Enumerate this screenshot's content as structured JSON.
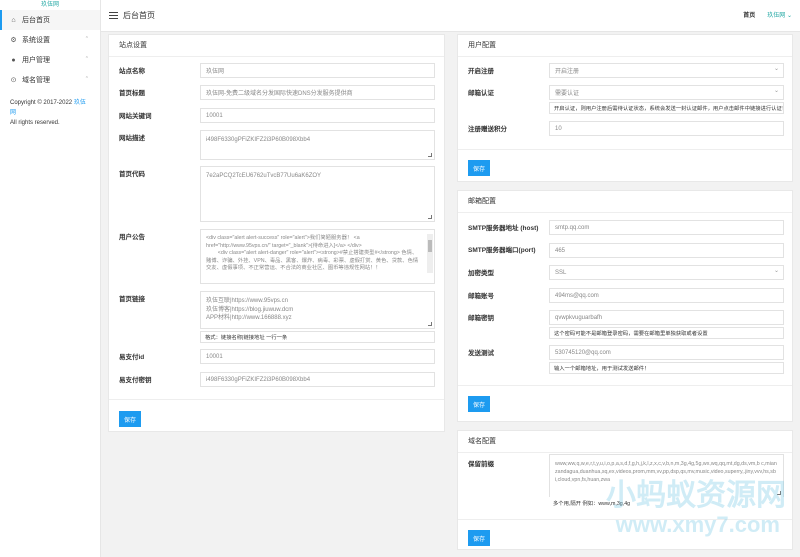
{
  "sidebar": {
    "logo": "玖伍网",
    "items": [
      {
        "label": "后台首页",
        "icon": "home-icon",
        "glyph": "⌂",
        "active": true
      },
      {
        "label": "系统设置",
        "icon": "settings-icon",
        "glyph": "⚙",
        "caret": "⌃"
      },
      {
        "label": "用户管理",
        "icon": "user-icon",
        "glyph": "●",
        "caret": "⌃"
      },
      {
        "label": "域名管理",
        "icon": "globe-icon",
        "glyph": "⊙",
        "caret": "⌃"
      }
    ],
    "copyright_prefix": "Copyright © 2017-2022",
    "copyright_link": "玖伍网",
    "copyright_suffix": "All rights reserved."
  },
  "topbar": {
    "title": "后台首页",
    "home_link": "首页",
    "user": "玖伍网 ⌄"
  },
  "site": {
    "header": "站点设置",
    "fields": {
      "name": {
        "label": "站点名称",
        "value": "玖伍网"
      },
      "home_title": {
        "label": "首页标题",
        "value": "玖伍网-免费二级域名分发国际快速DNS分发服务提供商"
      },
      "keywords": {
        "label": "网站关键词",
        "value": "10001"
      },
      "description": {
        "label": "网站描述",
        "value": "i498F6330gPFiZKIFZ2i3P60B098Xbb4"
      },
      "home_code": {
        "label": "首页代码",
        "value": "7e2aPCQ2TcEU6762uTvcB77Uu6aK6ZOY"
      },
      "notice": {
        "label": "用户公告",
        "value": "<div class=\"alert alert-success\" role=\"alert\">我们简陋服务器！ <a href=\"http://www.95vps.cn/\" target=\"_blank\">[待命进入]</a> </div>\n        <div class=\"alert alert-danger\" role=\"alert\"><strong>#禁止搭建类型#</strong> 色情、赌博、诈骗、外挂、VPN、毒品、黑客、爆炸、病毒、彩票、虚假打赏、黄色、贷款、色情交友、虚假事项、不正常营运、不合法的商业社区、图币等违规性网站！！"
      },
      "links": {
        "label": "首页链接",
        "value": "玖伍互联|https://www.95vps.cn\n玖伍博客|https://blog.jiuwuw.dcm\nAPP材料|http://www.166888.xyz",
        "hint": "格式：链接名称|链接地址 一行一条"
      },
      "pay_id": {
        "label": "易支付id",
        "value": "10001"
      },
      "pay_key": {
        "label": "易支付密钥",
        "value": "i498F6330gPFiZKIFZ2i3P60B098Xbb4"
      }
    },
    "save": "保存"
  },
  "user_cfg": {
    "header": "用户配置",
    "open_reg": {
      "label": "开启注册",
      "value": "开启注册"
    },
    "email_verify": {
      "label": "邮箱认证",
      "value": "需要认证",
      "hint": "开启认证，则用户注册后需待认证状态，系统会发送一封认证邮件，用户点击邮件中链接进行认证！"
    },
    "reg_points": {
      "label": "注册赠送积分",
      "value": "10"
    },
    "save": "保存"
  },
  "mail_cfg": {
    "header": "邮箱配置",
    "smtp_host": {
      "label": "SMTP服务器地址 (host)",
      "value": "smtp.qq.com"
    },
    "smtp_port": {
      "label": "SMTP服务器端口(port)",
      "value": "465"
    },
    "enc": {
      "label": "加密类型",
      "value": "SSL"
    },
    "account": {
      "label": "邮箱账号",
      "value": "494ms@qq.com"
    },
    "secret": {
      "label": "邮箱密钥",
      "value": "qvwpkvuguarbafh",
      "hint": "这个密码可能不是邮箱登录密码，需要在邮箱里单独获取或者设置"
    },
    "test": {
      "label": "发送测试",
      "value": "530745120@qq.com",
      "hint": "输入一个邮箱地址，用于测试发送邮件！"
    },
    "save": "保存"
  },
  "domain_cfg": {
    "header": "域名配置",
    "reserved": {
      "label": "保留前缀",
      "value": "www,ww,q,w,e,r,t,y,u,i,o,p,a,s,d,f,g,h,j,k,l,z,x,c,v,b,n,m,3g,4g,5g,wx,wq,qq,mt,dg,ds,vm,b c,mianzandagua,duanhua,sq,ex,videos,prom,mm,vv,pp,dsp,qs,mv,music,video,superry,.jiny,vvv,hs,sbi,cloud,vpn,fs,huan,zwa",
      "hint": "多个用,隔开 例如：www,m,3g,4g"
    },
    "save": "保存"
  },
  "watermark": {
    "line1": "小蚂蚁资源网",
    "line2": "www.xmy7.com"
  }
}
